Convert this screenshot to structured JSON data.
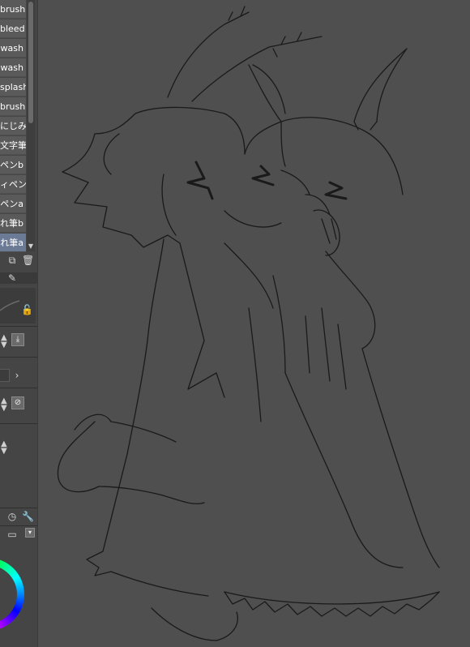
{
  "brush_list": {
    "items": [
      {
        "label": "brush"
      },
      {
        "label": "bleed"
      },
      {
        "label": "wash"
      },
      {
        "label": "wash"
      },
      {
        "label": "splash"
      },
      {
        "label": "brush"
      },
      {
        "label": "にじみ"
      },
      {
        "label": "文字筆"
      },
      {
        "label": "ペンb"
      },
      {
        "label": "ィペン"
      },
      {
        "label": "ペンa"
      },
      {
        "label": "れ筆b"
      },
      {
        "label": "れ筆a"
      }
    ],
    "selected_index": 12
  },
  "icons": {
    "duplicate": "duplicate-icon",
    "delete": "trash-icon",
    "lock": "lock-icon",
    "download": "download-icon",
    "chevron": "chevron-right-icon",
    "none": "no-entry-icon",
    "clock": "clock-icon",
    "wrench": "wrench-icon",
    "dropdown": "chevron-down-icon"
  },
  "colors": {
    "panel_bg": "#454545",
    "canvas_bg": "#4f4f4f",
    "line": "#1a1a1a"
  }
}
